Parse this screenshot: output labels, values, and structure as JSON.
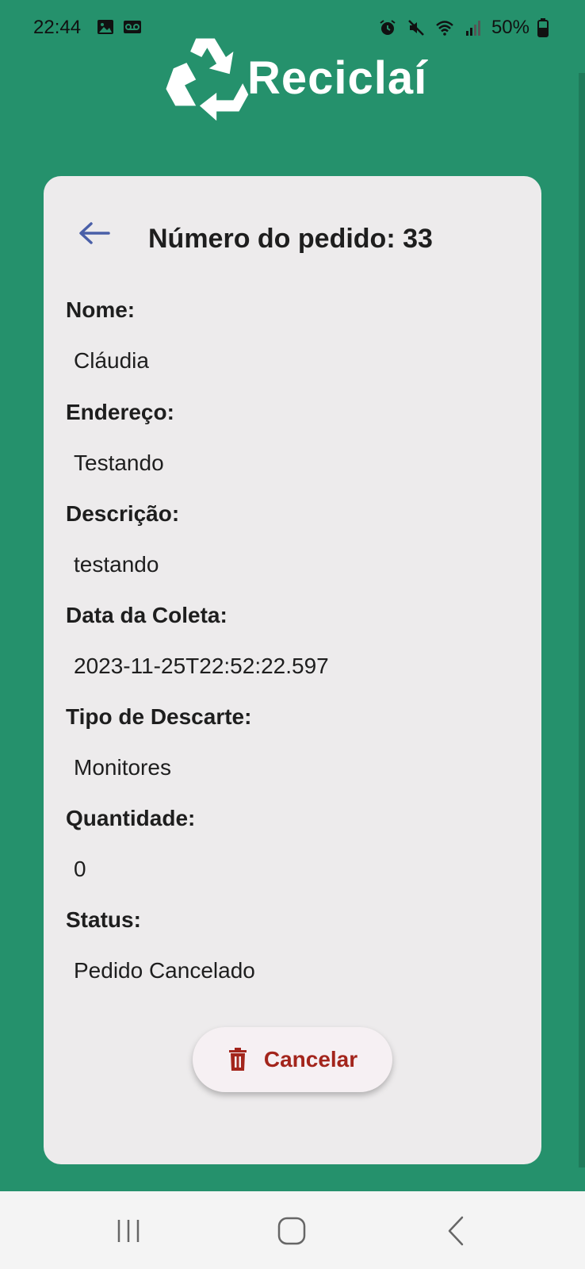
{
  "status_bar": {
    "time": "22:44",
    "battery": "50%",
    "left_icons": [
      "image-icon",
      "voicemail-icon"
    ],
    "right_icons": [
      "alarm-icon",
      "mute-icon",
      "wifi-icon",
      "signal-icon",
      "battery-icon"
    ]
  },
  "app": {
    "name": "Reciclaí",
    "brand_color": "#25916c"
  },
  "order": {
    "title": "Número do pedido: 33",
    "fields": [
      {
        "label": "Nome:",
        "value": "Cláudia"
      },
      {
        "label": "Endereço:",
        "value": "Testando"
      },
      {
        "label": "Descrição:",
        "value": "testando"
      },
      {
        "label": "Data da Coleta:",
        "value": "2023-11-25T22:52:22.597"
      },
      {
        "label": "Tipo de Descarte:",
        "value": "Monitores"
      },
      {
        "label": "Quantidade:",
        "value": "0"
      },
      {
        "label": "Status:",
        "value": "Pedido Cancelado"
      }
    ],
    "cancel_label": "Cancelar",
    "cancel_color": "#a3251c"
  },
  "nav_bar": {
    "buttons": [
      "recent-apps-icon",
      "home-icon",
      "back-icon"
    ]
  }
}
